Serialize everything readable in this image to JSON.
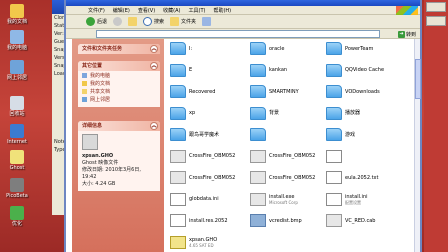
{
  "desktop": {
    "icons": [
      {
        "label": "我的文档",
        "color": "#f1c84b"
      },
      {
        "label": "我的电脑",
        "color": "#8fb8e6"
      },
      {
        "label": "网上邻居",
        "color": "#6fa3d9"
      },
      {
        "label": "回收站",
        "color": "#d6dde6"
      },
      {
        "label": "Internet",
        "color": "#3b7bd1"
      },
      {
        "label": "Ghost",
        "color": "#f0e27a"
      },
      {
        "label": "PicoBeta",
        "color": "#7e7e7e"
      },
      {
        "label": "优化",
        "color": "#4bb04b"
      }
    ]
  },
  "bgwindow": {
    "rows": [
      "Clone",
      "State:",
      "Ver:",
      "Guest",
      "Snap:",
      "Vers:",
      "Snap:",
      "Load:",
      "Notes:",
      "Type h"
    ]
  },
  "explorer": {
    "menu": [
      "文件(F)",
      "编辑(E)",
      "查看(V)",
      "收藏(A)",
      "工具(T)",
      "帮助(H)"
    ],
    "toolbar": {
      "back": "后退",
      "search": "搜索",
      "folders": "文件夹"
    },
    "address_go": "转到",
    "tasks": {
      "file_tasks": "文件和文件夹任务",
      "other_places": {
        "title": "其它位置",
        "links": [
          "我的电脑",
          "我的文档",
          "共享文档",
          "网上邻居"
        ]
      },
      "details": {
        "title": "详细信息",
        "filename": "xpsan.GHO",
        "type": "Ghost 映像文件",
        "modified": "修改日期: 2010年3月6日,",
        "time": "19:42",
        "size": "大小: 4.24 GB"
      }
    },
    "files": [
      {
        "name": "I:",
        "sub": "",
        "kind": "folder"
      },
      {
        "name": "oracle",
        "sub": "",
        "kind": "folder"
      },
      {
        "name": "PowerTeam",
        "sub": "",
        "kind": "folder"
      },
      {
        "name": "E",
        "sub": "",
        "kind": "folder"
      },
      {
        "name": "kankan",
        "sub": "",
        "kind": "folder"
      },
      {
        "name": "QQVideo Cache",
        "sub": "",
        "kind": "folder"
      },
      {
        "name": "Recovered",
        "sub": "",
        "kind": "folder"
      },
      {
        "name": "SMARTMINY",
        "sub": "",
        "kind": "folder"
      },
      {
        "name": "VODownloads",
        "sub": "",
        "kind": "folder"
      },
      {
        "name": "xp",
        "sub": "",
        "kind": "folder"
      },
      {
        "name": "背景",
        "sub": "",
        "kind": "folder"
      },
      {
        "name": "播放器",
        "sub": "",
        "kind": "folder"
      },
      {
        "name": "跟鸟哥学魔术",
        "sub": "",
        "kind": "folder"
      },
      {
        "name": "",
        "sub": "",
        "kind": "folder"
      },
      {
        "name": "游戏",
        "sub": "",
        "kind": "folder"
      },
      {
        "name": "CrossFire_OBM052",
        "sub": "",
        "kind": "app"
      },
      {
        "name": "CrossFire_OBM052",
        "sub": "",
        "kind": "app"
      },
      {
        "name": "",
        "sub": "",
        "kind": "doc"
      },
      {
        "name": "CrossFire_OBM052",
        "sub": "",
        "kind": "app"
      },
      {
        "name": "CrossFire_OBM052",
        "sub": "",
        "kind": "app"
      },
      {
        "name": "eula.2052.txt",
        "sub": "",
        "kind": "doc"
      },
      {
        "name": "globdata.ini",
        "sub": "",
        "kind": "doc"
      },
      {
        "name": "install.exe",
        "sub": "Microsoft Corp",
        "kind": "app"
      },
      {
        "name": "install.ini",
        "sub": "配置设置",
        "kind": "doc"
      },
      {
        "name": "install.res.2052",
        "sub": "",
        "kind": "doc"
      },
      {
        "name": "vcredist.bmp",
        "sub": "",
        "kind": "img"
      },
      {
        "name": "VC_RED.cab",
        "sub": "",
        "kind": "app"
      },
      {
        "name": "xpsan.GHO",
        "sub": "4.65 SAT ED",
        "kind": "ghost"
      }
    ]
  }
}
